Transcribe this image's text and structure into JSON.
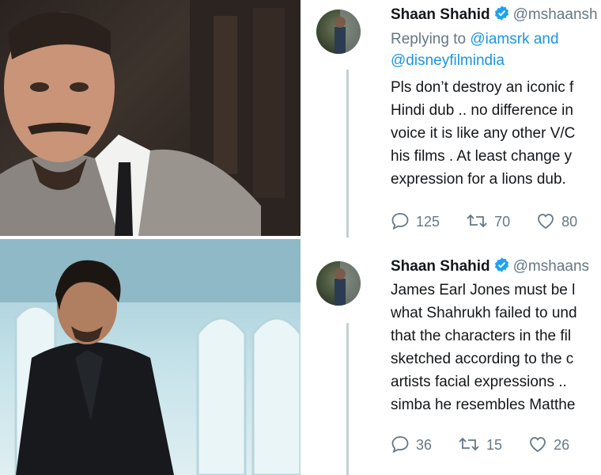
{
  "tweets": [
    {
      "name": "Shaan Shahid",
      "handle": "@mshaansh",
      "reply_prefix": "Replying to",
      "reply_mention_1": "@iamsrk",
      "reply_and": "and",
      "reply_mention_2": "@disneyfilmindia",
      "lines": [
        "Pls don’t destroy an iconic f",
        "Hindi dub .. no difference in",
        "voice it is like any other V/C",
        "his films . At least change y",
        "expression for a lions dub."
      ],
      "replies": "125",
      "retweets": "70",
      "likes": "80"
    },
    {
      "name": "Shaan Shahid",
      "handle": "@mshaans",
      "lines": [
        "James Earl Jones must be l",
        "what Shahrukh failed to und",
        "that the characters in the fil",
        "sketched according to the c",
        "artists facial expressions ..",
        "simba he resembles Matthe"
      ],
      "replies": "36",
      "retweets": "15",
      "likes": "26"
    }
  ],
  "icons": {
    "verified": "verified-badge-icon",
    "reply": "reply-icon",
    "retweet": "retweet-icon",
    "like": "heart-icon"
  },
  "colors": {
    "verified": "#1da1f2",
    "link": "#1b95e0",
    "secondary": "#657786",
    "thread_line": "#c4cfd6"
  }
}
